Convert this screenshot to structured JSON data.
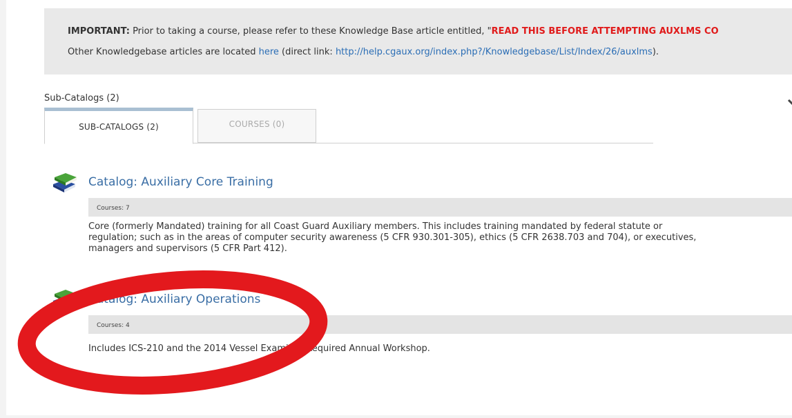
{
  "notice": {
    "important_label": "IMPORTANT:",
    "line1_text": " Prior to taking a course, please refer to these Knowledge Base article entitled, \"",
    "line1_red": "READ THIS BEFORE ATTEMPTING AUXLMS CO",
    "line2_prefix": "Other Knowledgebase articles are located ",
    "here_link": "here",
    "line2_middle": " (direct link: ",
    "direct_link": "http://help.cgaux.org/index.php?/Knowledgebase/List/Index/26/auxlms",
    "line2_suffix": ")."
  },
  "subcatalogs": {
    "heading": "Sub-Catalogs (2)",
    "tabs": [
      {
        "label": "SUB-CATALOGS (2)",
        "active": true
      },
      {
        "label": "COURSES (0)",
        "active": false
      }
    ]
  },
  "catalogs": [
    {
      "title": "Catalog: Auxiliary Core Training",
      "courses": "Courses: 7",
      "description_lines": [
        "Core (formerly Mandated) training for all Coast Guard Auxiliary members. This includes training mandated by federal statute or",
        "regulation; such as in the areas of computer security awareness (5 CFR 930.301-305), ethics (5 CFR 2638.703 and 704), or executives,",
        "managers and supervisors (5 CFR Part 412)."
      ]
    },
    {
      "title": "Catalog: Auxiliary Operations",
      "courses": "Courses: 4",
      "description_lines": [
        "Includes ICS-210 and the 2014 Vessel Examiner Required Annual Workshop."
      ]
    }
  ],
  "colors": {
    "accent_link": "#3a6ea5",
    "important_red": "#e01b1b",
    "annotation_oval": "#e3191d"
  },
  "icons": {
    "catalog": "books-icon",
    "collapse": "chevron-down-icon"
  }
}
